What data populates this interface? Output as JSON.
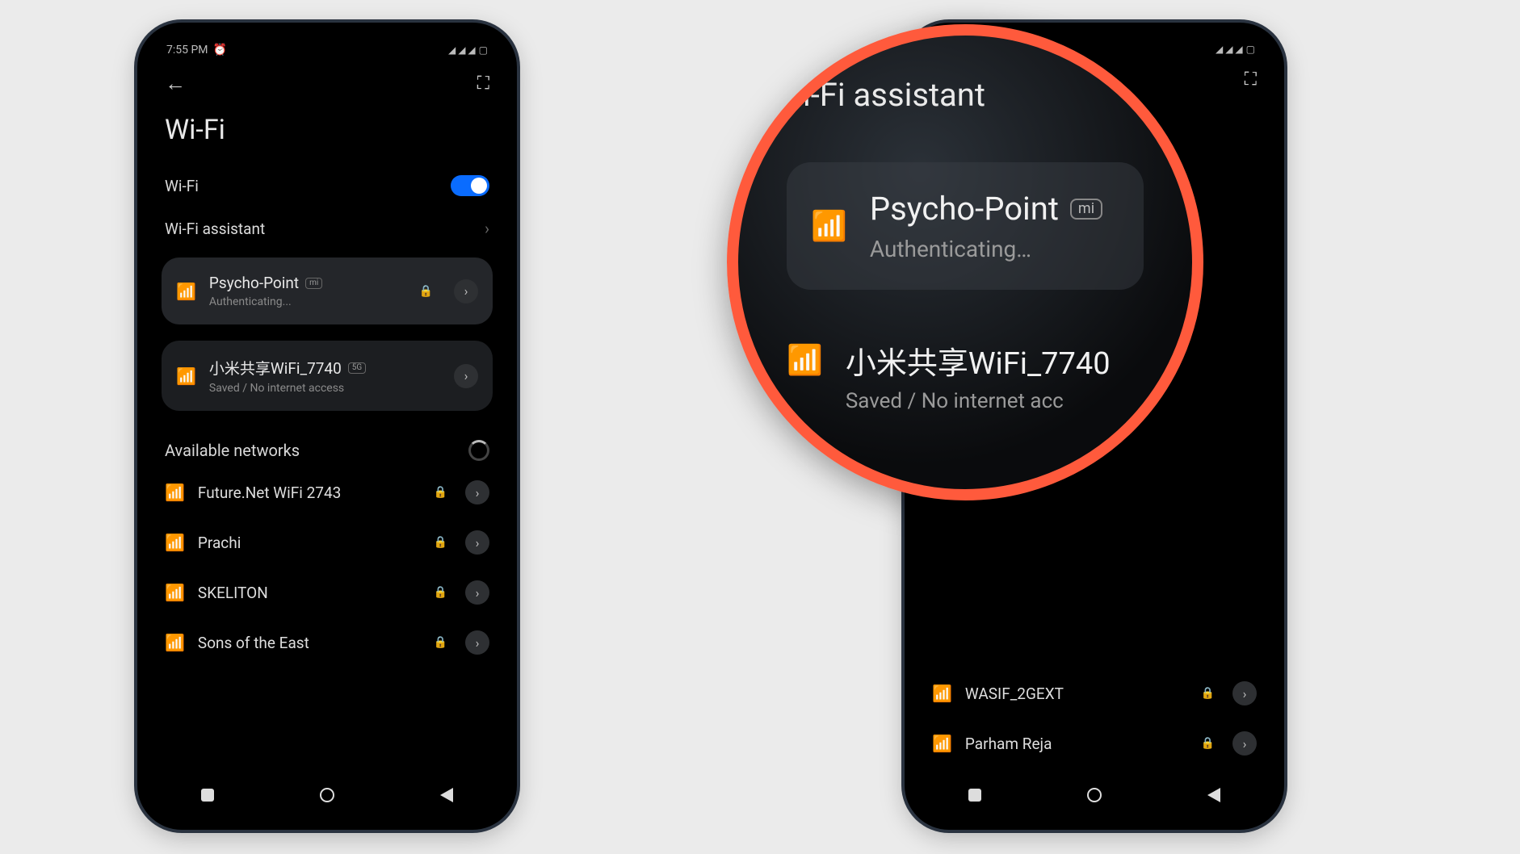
{
  "status": {
    "time": "7:55 PM",
    "signal_text": "◢ ◢ ◢",
    "battery_text": "▢"
  },
  "page": {
    "title": "Wi-Fi",
    "wifi_label": "Wi-Fi",
    "assistant_label": "Wi-Fi assistant",
    "available_label": "Available networks"
  },
  "connected": [
    {
      "name": "Psycho-Point",
      "badge": "mi",
      "sub": "Authenticating...",
      "locked": true
    },
    {
      "name": "小米共享WiFi_7740",
      "badge": "5G",
      "sub": "Saved / No internet access",
      "locked": false
    }
  ],
  "networks_left": [
    {
      "name": "Future.Net WiFi 2743",
      "locked": true
    },
    {
      "name": "Prachi",
      "locked": true
    },
    {
      "name": "SKELITON",
      "locked": true
    },
    {
      "name": "Sons of the East",
      "locked": true
    }
  ],
  "networks_right": [
    {
      "name": "WASIF_2GEXT",
      "locked": true
    },
    {
      "name": "Parham Reja",
      "locked": true
    }
  ],
  "zoom": {
    "title": "i-Fi assistant",
    "n1_name": "Psycho-Point",
    "n1_badge": "mi",
    "n1_sub": "Authenticating…",
    "n2_name": "小米共享WiFi_7740",
    "n2_sub": "Saved / No internet acc"
  }
}
